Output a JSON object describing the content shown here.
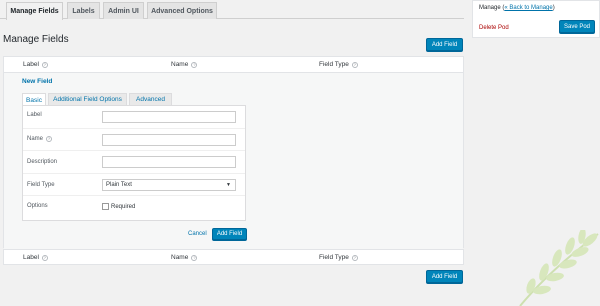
{
  "tabs": [
    "Manage Fields",
    "Labels",
    "Admin UI",
    "Advanced Options"
  ],
  "page_title": "Manage Fields",
  "add_field_label": "Add Field",
  "columns": {
    "label": "Label",
    "name": "Name",
    "field_type": "Field Type"
  },
  "help_glyph": "?",
  "new_field_title": "New Field",
  "subtabs": [
    "Basic",
    "Additional Field Options",
    "Advanced"
  ],
  "form": {
    "label_label": "Label",
    "name_label": "Name",
    "description_label": "Description",
    "field_type_label": "Field Type",
    "field_type_value": "Plain Text",
    "options_label": "Options",
    "required_label": "Required"
  },
  "cancel_label": "Cancel",
  "sidebar": {
    "manage_label": "Manage",
    "back_link": "« Back to Manage",
    "delete_label": "Delete Pod",
    "save_label": "Save Pod"
  },
  "colors": {
    "accent": "#0085ba",
    "link": "#0073aa",
    "danger": "#aa0000"
  },
  "icons": [
    "help-icon",
    "dropdown-arrow-icon",
    "leaf-decoration-icon"
  ]
}
